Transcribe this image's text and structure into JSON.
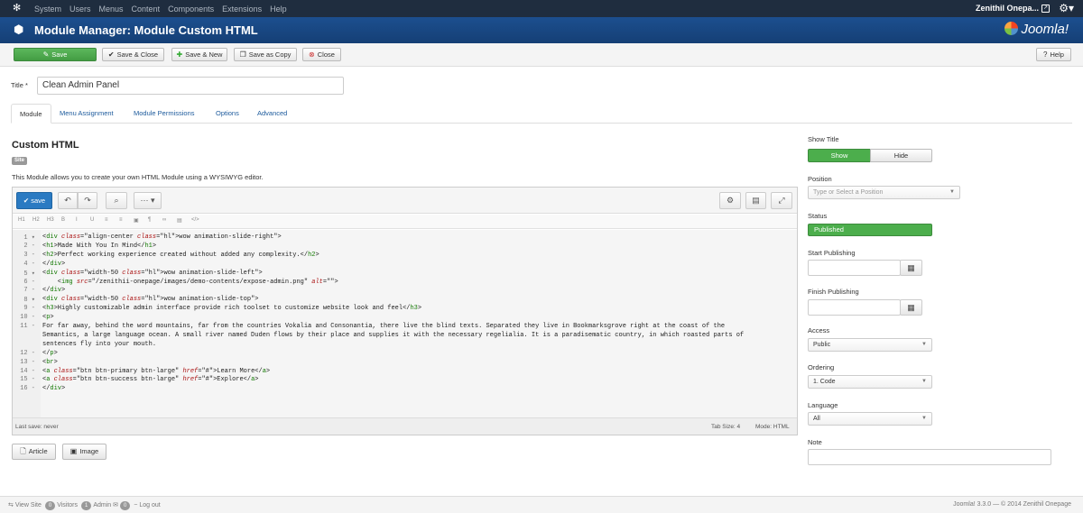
{
  "topnav": {
    "menu": [
      "System",
      "Users",
      "Menus",
      "Content",
      "Components",
      "Extensions",
      "Help"
    ],
    "site_name": "Zenithil Onepa..."
  },
  "header": {
    "title": "Module Manager: Module Custom HTML",
    "brand": "Joomla!"
  },
  "toolbar": {
    "save": "Save",
    "save_close": "Save & Close",
    "save_new": "Save & New",
    "save_copy": "Save as Copy",
    "close": "Close",
    "help": "Help"
  },
  "form": {
    "title_label": "Title *",
    "title_value": "Clean Admin Panel"
  },
  "tabs": [
    "Module",
    "Menu Assignment",
    "Module Permissions",
    "Options",
    "Advanced"
  ],
  "module": {
    "heading": "Custom HTML",
    "badge": "Site",
    "description": "This Module allows you to create your own HTML Module using a WYSIWYG editor."
  },
  "editor": {
    "save_label": "save",
    "format_icons": [
      "H1",
      "H2",
      "H3",
      "B",
      "I",
      "U",
      "≡",
      "≡",
      "▣",
      "¶",
      "∞",
      "▤",
      "</>"
    ],
    "lines": [
      {
        "n": "1",
        "text": "<div class=\"align-center wow animation-slide-right\">"
      },
      {
        "n": "2",
        "text": "<h1>Made With You In Mind</h1>"
      },
      {
        "n": "3",
        "text": "<h2>Perfect working experience created without added any complexity.</h2>"
      },
      {
        "n": "4",
        "text": "</div>"
      },
      {
        "n": "5",
        "text": "<div class=\"width-50 wow animation-slide-left\">"
      },
      {
        "n": "6",
        "text": "    <img src=\"/zenithii-onepage/images/demo-contents/expose-admin.png\" alt=\"\">"
      },
      {
        "n": "7",
        "text": "</div>"
      },
      {
        "n": "8",
        "text": "<div class=\"width-50 wow animation-slide-top\">"
      },
      {
        "n": "9",
        "text": "<h3>Highly customizable admin interface provide rich toolset to customize website look and feel</h3>"
      },
      {
        "n": "10",
        "text": "<p>"
      },
      {
        "n": "11",
        "text": "For far away, behind the word mountains, far from the countries Vokalia and Consonantia, there live the blind texts. Separated they live in Bookmarksgrove right at the coast of the"
      },
      {
        "n": "",
        "text": "Semantics, a large language ocean. A small river named Duden flows by their place and supplies it with the necessary regelialia. It is a paradisematic country, in which roasted parts of"
      },
      {
        "n": "",
        "text": "sentences fly into your mouth."
      },
      {
        "n": "12",
        "text": "</p>"
      },
      {
        "n": "13",
        "text": "<br>"
      },
      {
        "n": "14",
        "text": "<a class=\"btn btn-primary btn-large\" href=\"#\">Learn More</a>"
      },
      {
        "n": "15",
        "text": "<a class=\"btn btn-success btn-large\" href=\"#\">Explore</a>"
      },
      {
        "n": "16",
        "text": "</div>"
      }
    ],
    "last_save": "Last save: never",
    "tab_size": "Tab Size: 4",
    "mode": "Mode: HTML"
  },
  "editor_buttons": {
    "article": "Article",
    "image": "Image"
  },
  "sidebar": {
    "show_title_label": "Show Title",
    "show": "Show",
    "hide": "Hide",
    "position_label": "Position",
    "position_placeholder": "Type or Select a Position",
    "status_label": "Status",
    "status_value": "Published",
    "start_label": "Start Publishing",
    "finish_label": "Finish Publishing",
    "access_label": "Access",
    "access_value": "Public",
    "ordering_label": "Ordering",
    "ordering_value": "1. Code",
    "language_label": "Language",
    "language_value": "All",
    "note_label": "Note"
  },
  "footer": {
    "view_site": "View Site",
    "visitors_count": "0",
    "visitors": "Visitors",
    "admin_count": "1",
    "admin": "Admin",
    "messages_count": "0",
    "logout": "Log out",
    "version": "Joomla! 3.3.0 — © 2014 Zenithil Onepage"
  },
  "colors": {
    "topnav": "#1f2d3f",
    "titlebar": "#1c4f8f",
    "save": "#5cb85c",
    "editor_save": "#2a7ac2",
    "highlight": "#fff200"
  }
}
